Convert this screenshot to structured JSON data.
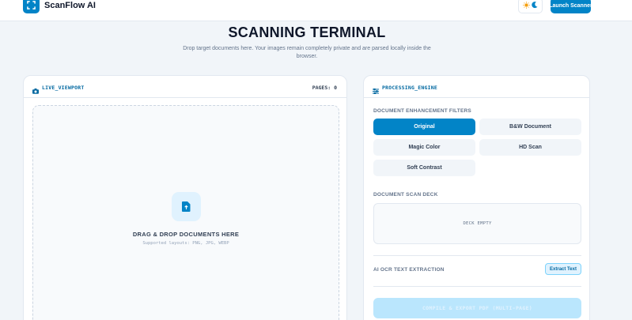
{
  "brand": {
    "name": "ScanFlow AI",
    "logo_icon": "scan-frame-icon"
  },
  "header": {
    "theme_toggle": {
      "sun_icon": "sun-icon",
      "moon_icon": "moon-icon"
    },
    "launch_label": "Launch Scanner"
  },
  "hero": {
    "title": "SCANNING TERMINAL",
    "subtitle": "Drop target documents here. Your images remain completely private and are parsed locally inside the browser."
  },
  "viewport": {
    "label": "LIVE_VIEWPORT",
    "pages_label": "PAGES: 0",
    "drop_title": "DRAG & DROP DOCUMENTS HERE",
    "drop_sub": "Supported layouts: PNG, JPG, WEBP"
  },
  "engine": {
    "label": "PROCESSING_ENGINE",
    "filters_label": "DOCUMENT ENHANCEMENT FILTERS",
    "filters": [
      {
        "label": "Original",
        "active": true
      },
      {
        "label": "B&W Document",
        "active": false
      },
      {
        "label": "Magic Color",
        "active": false
      },
      {
        "label": "HD Scan",
        "active": false
      },
      {
        "label": "Soft Contrast",
        "active": false
      }
    ],
    "deck_label": "DOCUMENT SCAN DECK",
    "deck_empty": "DECK EMPTY",
    "ocr_label": "AI OCR TEXT EXTRACTION",
    "extract_label": "Extract Text",
    "compile_label": "COMPILE & EXPORT PDF (MULTI-PAGE)"
  },
  "colors": {
    "accent": "#0284c7",
    "background": "#f1f5f9"
  }
}
